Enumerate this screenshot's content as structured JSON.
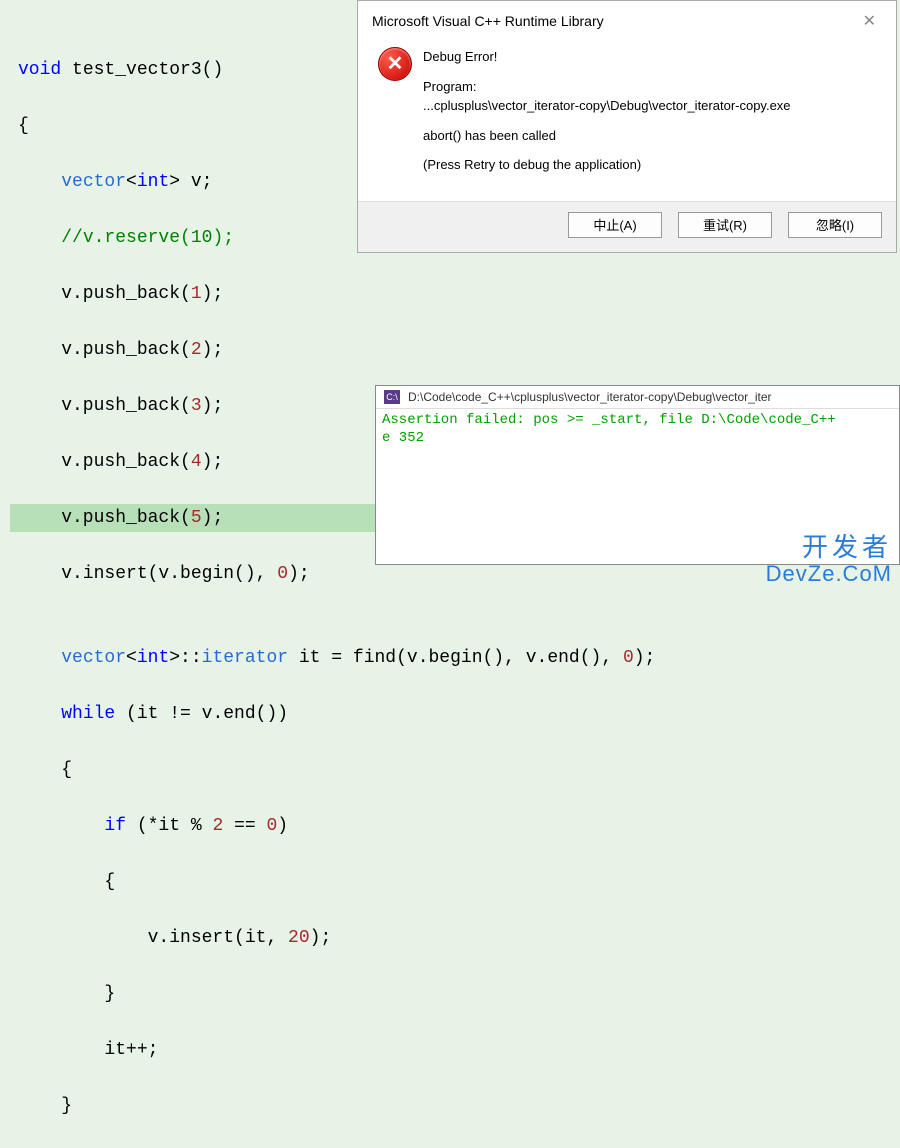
{
  "code": {
    "lines": [
      {
        "raw": "void test_vector3()"
      },
      {
        "raw": "{"
      },
      {
        "raw": "    vector<int> v;"
      },
      {
        "raw": "    //v.reserve(10);"
      },
      {
        "raw": "    v.push_back(1);"
      },
      {
        "raw": "    v.push_back(2);"
      },
      {
        "raw": "    v.push_back(3);"
      },
      {
        "raw": "    v.push_back(4);"
      },
      {
        "raw": "    v.push_back(5);",
        "hl": true
      },
      {
        "raw": "    v.insert(v.begin(), 0);"
      },
      {
        "raw": ""
      },
      {
        "raw": "    vector<int>::iterator it = find(v.begin(), v.end(), 0);"
      },
      {
        "raw": "    while (it != v.end())"
      },
      {
        "raw": "    {"
      },
      {
        "raw": "        if (*it % 2 == 0)"
      },
      {
        "raw": "        {"
      },
      {
        "raw": "            v.insert(it, 20);"
      },
      {
        "raw": "        }"
      },
      {
        "raw": "        it++;"
      },
      {
        "raw": "    }"
      }
    ]
  },
  "dialog": {
    "title": "Microsoft Visual C++ Runtime Library",
    "heading": "Debug Error!",
    "program_label": "Program:",
    "program_path": "...cplusplus\\vector_iterator-copy\\Debug\\vector_iterator-copy.exe",
    "abort_msg": "abort() has been called",
    "retry_msg": "(Press Retry to debug the application)",
    "buttons": {
      "abort": "中止(A)",
      "retry": "重试(R)",
      "ignore": "忽略(I)"
    }
  },
  "console": {
    "title": "D:\\Code\\code_C++\\cplusplus\\vector_iterator-copy\\Debug\\vector_iter",
    "line1": "Assertion failed: pos >= _start, file D:\\Code\\code_C++",
    "line2": "e 352"
  },
  "watermark": {
    "cn": "开发者",
    "en": "DevZe.CoM"
  }
}
